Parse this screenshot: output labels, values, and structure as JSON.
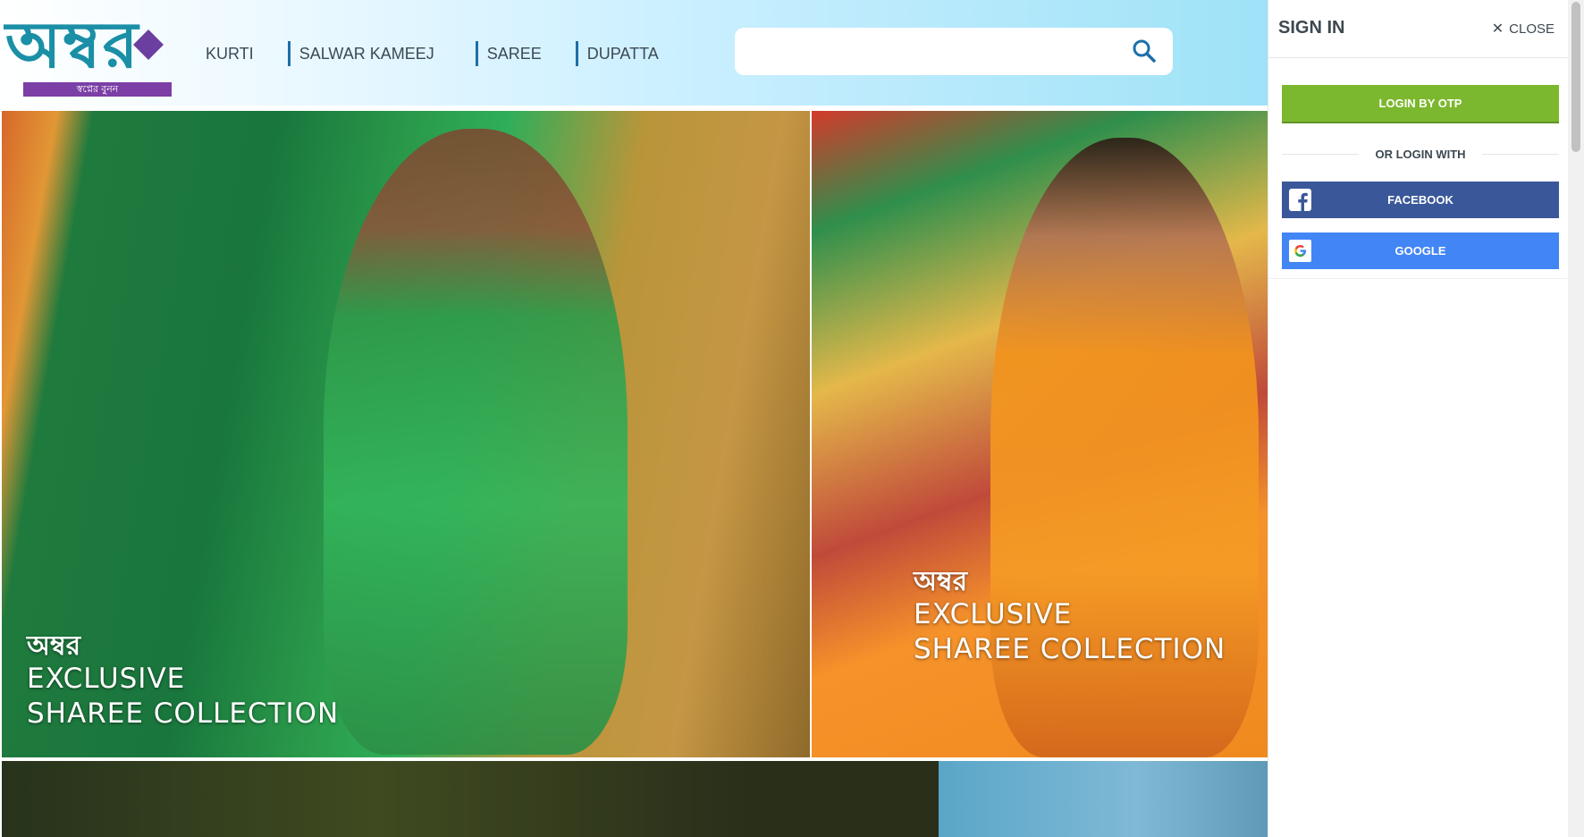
{
  "brand": {
    "logo_text": "অম্বর",
    "tagline": "স্বপ্নের বুনন",
    "colors": {
      "teal": "#1a8fa6",
      "purple": "#7b3fa6"
    }
  },
  "nav": {
    "items": [
      {
        "label": "KURTI"
      },
      {
        "label": "SALWAR KAMEEJ"
      },
      {
        "label": "SAREE"
      },
      {
        "label": "DUPATTA"
      }
    ]
  },
  "search": {
    "placeholder": "",
    "icon": "search-icon"
  },
  "banners": [
    {
      "brand": "অম্বর",
      "line1": "EXCLUSIVE",
      "line2": "SHAREE COLLECTION"
    },
    {
      "brand": "অম্বর",
      "line1": "EXCLUSIVE",
      "line2": "SHAREE COLLECTION"
    }
  ],
  "signin": {
    "title": "SIGN IN",
    "close_label": "CLOSE",
    "otp_label": "LOGIN BY OTP",
    "or_label": "OR LOGIN WITH",
    "facebook_label": "FACEBOOK",
    "google_label": "GOOGLE",
    "colors": {
      "otp": "#7cb82f",
      "facebook": "#3a5899",
      "google": "#4285f4"
    }
  }
}
